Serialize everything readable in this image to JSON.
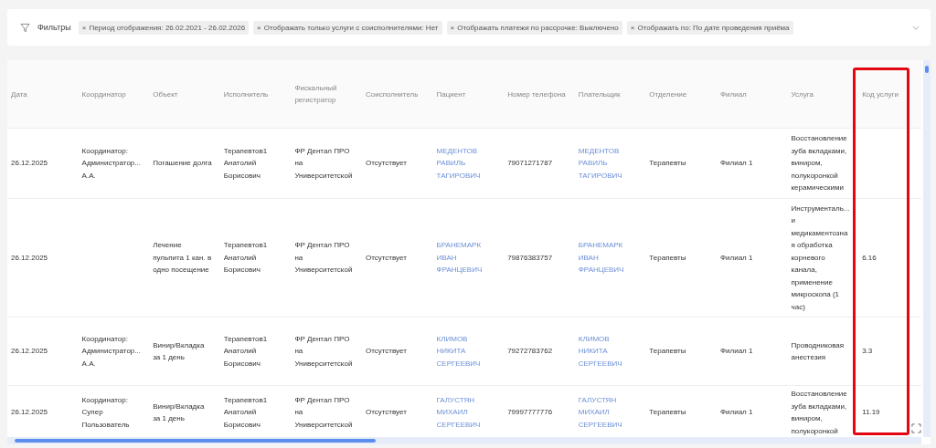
{
  "filters": {
    "title": "Фильтры",
    "chips": [
      {
        "remove": "×",
        "label": "Период отображения: 26.02.2021 - 26.02.2026"
      },
      {
        "remove": "×",
        "label": "Отображать только услуги с соисполнителями: Нет"
      },
      {
        "remove": "×",
        "label": "Отображать платежи по рассрочке: Выключено"
      },
      {
        "remove": "×",
        "label": "Отображать по: По дате проведения приёма"
      }
    ]
  },
  "table": {
    "columns": [
      {
        "label": "Дата",
        "kind": "text"
      },
      {
        "label": "Координатор",
        "kind": "text"
      },
      {
        "label": "Объект",
        "kind": "text"
      },
      {
        "label": "Исполнитель",
        "kind": "text"
      },
      {
        "label": "Фискальный регистратор",
        "kind": "text"
      },
      {
        "label": "Соисполнитель",
        "kind": "text"
      },
      {
        "label": "Пациент",
        "kind": "link"
      },
      {
        "label": "Номер телефона",
        "kind": "text"
      },
      {
        "label": "Плательщик",
        "kind": "link"
      },
      {
        "label": "Отделение",
        "kind": "text"
      },
      {
        "label": "Филиал",
        "kind": "text"
      },
      {
        "label": "Услуга",
        "kind": "text"
      },
      {
        "label": "Код услуги",
        "kind": "text",
        "highlighted": true
      }
    ],
    "rows": [
      {
        "cells": [
          "26.12.2025",
          "Координатор: Администратор... А.А.",
          "Погашение долга",
          "Терапевтов1 Анатолий Борисович",
          "ФР Дентал ПРО на Университетской",
          "Отсутствует",
          "МЕДЕНТОВ РАВИЛЬ ТАГИРОВИЧ",
          "79071271787",
          "МЕДЕНТОВ РАВИЛЬ ТАГИРОВИЧ",
          "Терапевты",
          "Филиал 1",
          "Восстановление зуба вкладками, виниром, полукоронкой керамическими",
          ""
        ]
      },
      {
        "cells": [
          "26.12.2025",
          "",
          "Лечение пульпита 1 кан. в одно посещение",
          "Терапевтов1 Анатолий Борисович",
          "ФР Дентал ПРО на Университетской",
          "Отсутствует",
          "БРАНЕМАРК ИВАН ФРАНЦЕВИЧ",
          "79876383757",
          "БРАНЕМАРК ИВАН ФРАНЦЕВИЧ",
          "Терапевты",
          "Филиал 1",
          "Инструменталь... и медикаментозная обработка корневого канала, применение микроскопа (1 час)",
          "6.16"
        ]
      },
      {
        "cells": [
          "26.12.2025",
          "Координатор: Администратор... А.А.",
          "Винир/Вкладка за 1 день",
          "Терапевтов1 Анатолий Борисович",
          "ФР Дентал ПРО на Университетской",
          "Отсутствует",
          "КЛИМОВ НИКИТА СЕРГЕЕВИЧ",
          "79272783762",
          "КЛИМОВ НИКИТА СЕРГЕЕВИЧ",
          "Терапевты",
          "Филиал 1",
          "Проводниковая анестезия",
          "3.3"
        ]
      },
      {
        "cells": [
          "26.12.2025",
          "Координатор: Супер Пользователь",
          "Винир/Вкладка за 1 день",
          "Терапевтов1 Анатолий Борисович",
          "ФР Дентал ПРО на Университетской",
          "Отсутствует",
          "ГАЛУСТЯН МИХАИЛ СЕРГЕЕВИЧ",
          "79997777776",
          "ГАЛУСТЯН МИХАИЛ СЕРГЕЕВИЧ",
          "Терапевты",
          "Филиал 1",
          "Восстановление зуба вкладками, виниром, полукоронкой",
          "11.19"
        ]
      }
    ]
  }
}
